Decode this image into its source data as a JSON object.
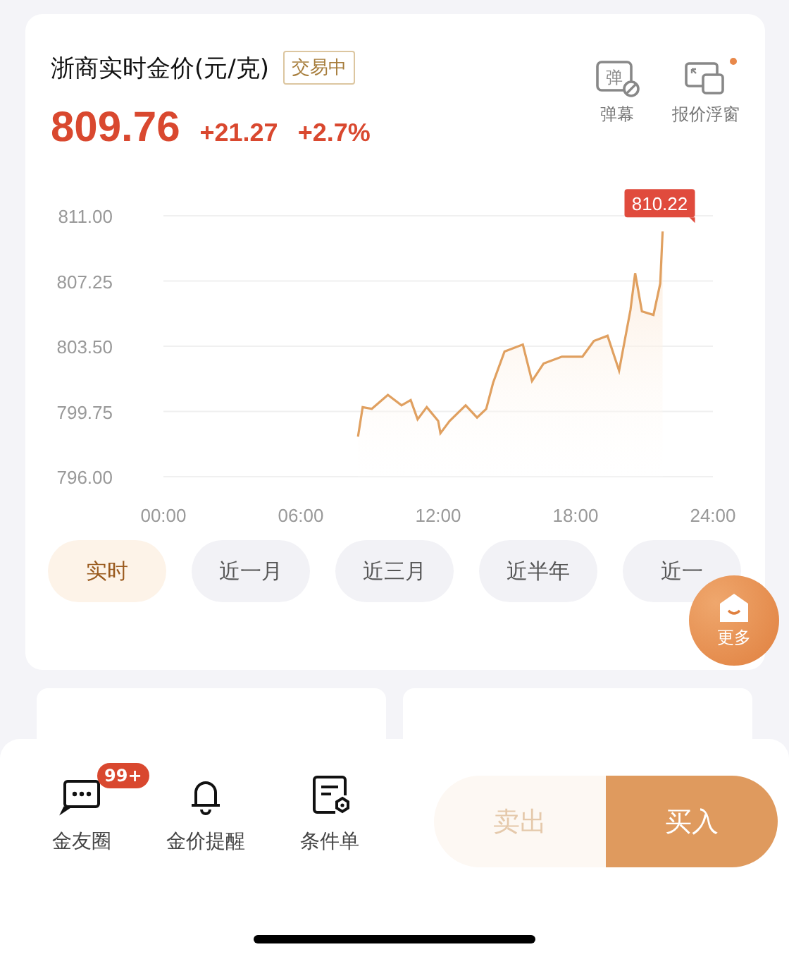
{
  "header": {
    "title": "浙商实时金价(元/克)",
    "status_badge": "交易中",
    "price": "809.76",
    "change": "+21.27",
    "change_percent": "+2.7%",
    "tools": [
      {
        "kind": "danmaku",
        "icon_text": "弹",
        "label": "弹幕"
      },
      {
        "kind": "float",
        "label": "报价浮窗",
        "dot": true
      }
    ]
  },
  "chart": {
    "chart_data": {
      "type": "line",
      "x": [
        8.5,
        8.7,
        9.1,
        9.8,
        10.4,
        10.8,
        11.1,
        11.5,
        12.0,
        12.1,
        12.5,
        13.2,
        13.7,
        14.1,
        14.4,
        14.9,
        15.7,
        16.1,
        16.6,
        17.4,
        18.3,
        18.8,
        19.4,
        19.9,
        20.4,
        20.6,
        20.9,
        21.4,
        21.7,
        21.8
      ],
      "series": [
        {
          "color": "#e0a060",
          "values": [
            798.3,
            800.0,
            799.9,
            800.7,
            800.1,
            800.4,
            799.3,
            800.0,
            799.2,
            798.5,
            799.2,
            800.1,
            799.4,
            799.9,
            801.4,
            803.2,
            803.6,
            801.5,
            802.5,
            802.9,
            802.9,
            803.8,
            804.1,
            802.1,
            805.6,
            807.7,
            805.5,
            805.3,
            807.1,
            810.1
          ]
        }
      ],
      "grid": true,
      "xlim": [
        0,
        24
      ],
      "ylim": [
        796,
        811
      ],
      "xticks": [
        {
          "value": 0,
          "label": "00:00"
        },
        {
          "value": 6,
          "label": "06:00"
        },
        {
          "value": 12,
          "label": "12:00"
        },
        {
          "value": 18,
          "label": "18:00"
        },
        {
          "value": 24,
          "label": "24:00"
        }
      ],
      "yticks": [
        {
          "value": 811,
          "label": "811.00"
        },
        {
          "value": 807.25,
          "label": "807.25"
        },
        {
          "value": 803.5,
          "label": "803.50"
        },
        {
          "value": 799.75,
          "label": "799.75"
        },
        {
          "value": 796,
          "label": "796.00"
        }
      ],
      "annotations": [
        {
          "x": 21.8,
          "y": 810.1,
          "text": "810.22"
        }
      ]
    }
  },
  "ranges": [
    {
      "label": "实时",
      "selected": true
    },
    {
      "label": "近一月",
      "selected": false
    },
    {
      "label": "近三月",
      "selected": false
    },
    {
      "label": "近半年",
      "selected": false
    },
    {
      "label": "近一",
      "selected": false
    }
  ],
  "more_button": {
    "label": "更多"
  },
  "bottom_nav": [
    {
      "kind": "chat",
      "label": "金友圈",
      "badge": "99+"
    },
    {
      "kind": "bell",
      "label": "金价提醒"
    },
    {
      "kind": "order",
      "label": "条件单"
    }
  ],
  "actions": [
    {
      "kind": "sell",
      "label": "卖出",
      "disabled": true
    },
    {
      "kind": "buy",
      "label": "买入",
      "disabled": false
    }
  ]
}
